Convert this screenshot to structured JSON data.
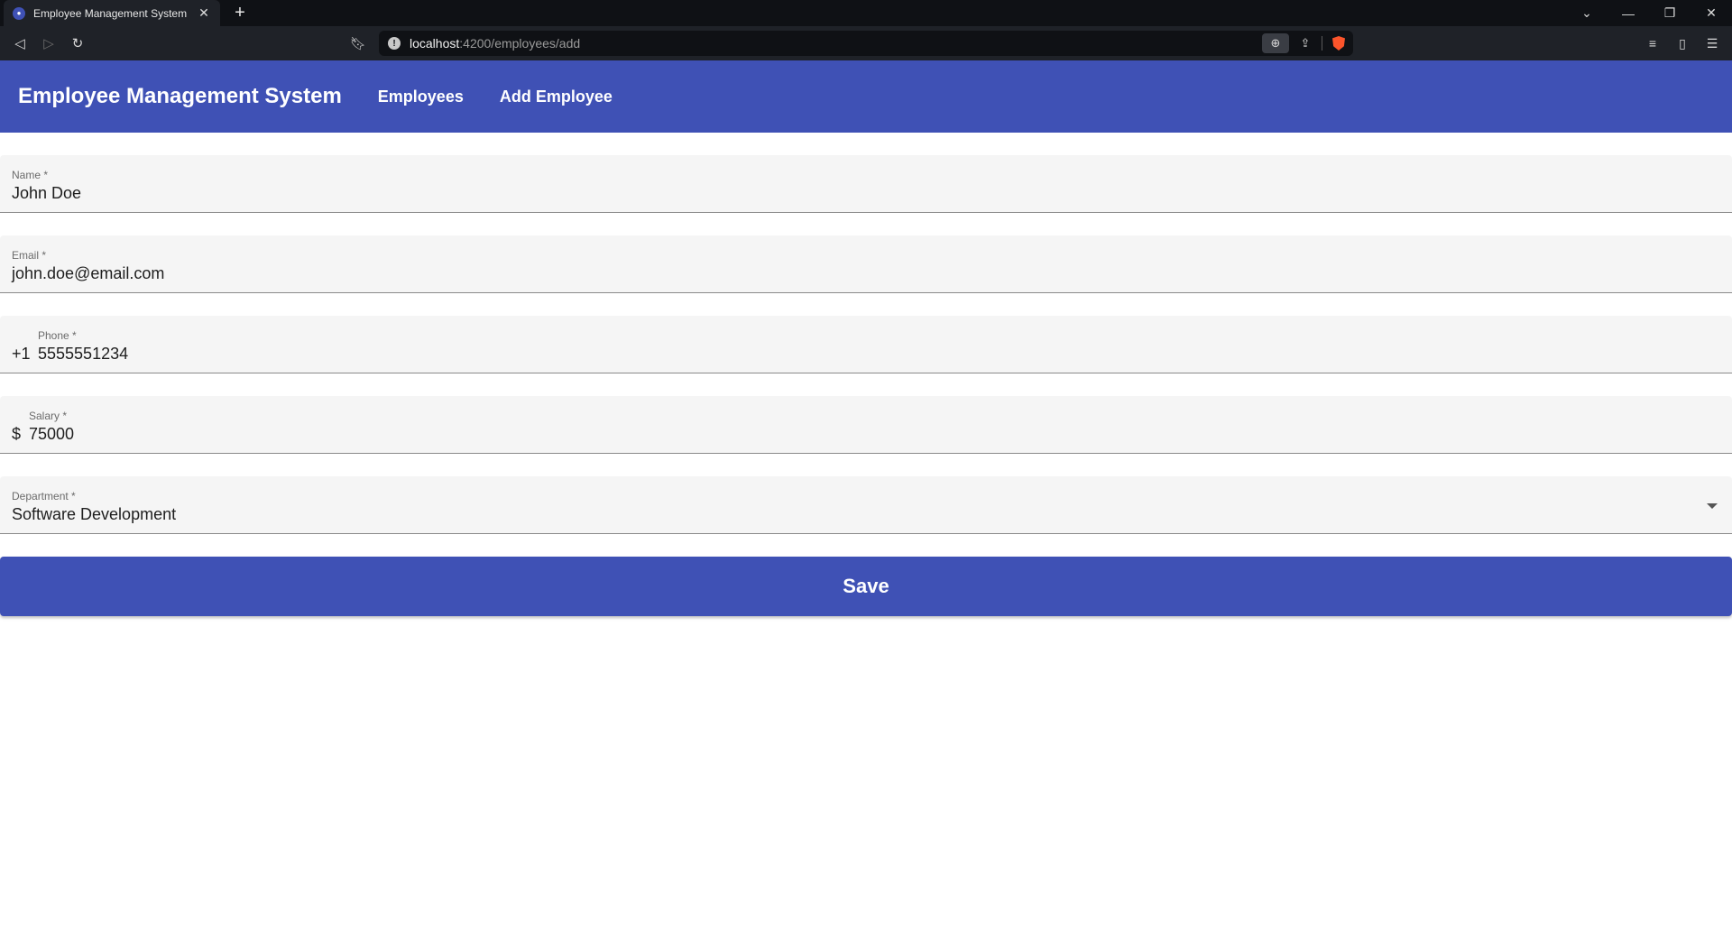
{
  "browser": {
    "tab_title": "Employee Management System",
    "url_host": "localhost",
    "url_path": ":4200/employees/add",
    "new_tab_icon": "plus-icon",
    "close_tab_icon": "close-icon"
  },
  "app": {
    "title": "Employee Management System",
    "nav": [
      {
        "label": "Employees"
      },
      {
        "label": "Add Employee"
      }
    ],
    "brand_color": "#3f51b5"
  },
  "form": {
    "name": {
      "label": "Name *",
      "value": "John Doe"
    },
    "email": {
      "label": "Email *",
      "value": "john.doe@email.com"
    },
    "phone": {
      "label": "Phone *",
      "prefix": "+1",
      "value": "5555551234"
    },
    "salary": {
      "label": "Salary *",
      "prefix": "$",
      "value": "75000"
    },
    "department": {
      "label": "Department *",
      "value": "Software Development"
    },
    "save_label": "Save"
  }
}
